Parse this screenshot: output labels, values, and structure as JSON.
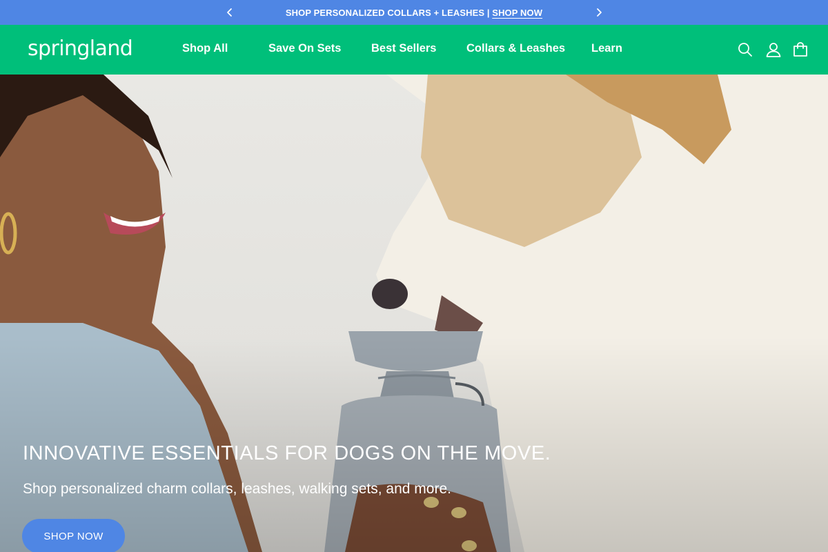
{
  "announcement": {
    "message": "SHOP PERSONALIZED COLLARS + LEASHES |",
    "link": "SHOP NOW",
    "prev_icon": "chevron-left-icon",
    "next_icon": "chevron-right-icon"
  },
  "header": {
    "logo": "springland",
    "nav": [
      {
        "label": "Shop All"
      },
      {
        "label": "Save On Sets"
      },
      {
        "label": "Best Sellers"
      },
      {
        "label": "Collars & Leashes"
      },
      {
        "label": "Learn"
      }
    ],
    "icons": [
      "search-icon",
      "account-icon",
      "cart-icon"
    ]
  },
  "hero": {
    "title": "INNOVATIVE ESSENTIALS FOR DOGS ON THE MOVE.",
    "subtitle": "Shop personalized charm collars, leashes, walking sets, and more.",
    "cta": "SHOP NOW",
    "image": "woman-holding-dog-water-bottle-photo"
  },
  "colors": {
    "announcement_bg": "#4f86e4",
    "header_bg": "#00bf7a",
    "button_bg": "#4f86e4",
    "text": "#ffffff"
  }
}
